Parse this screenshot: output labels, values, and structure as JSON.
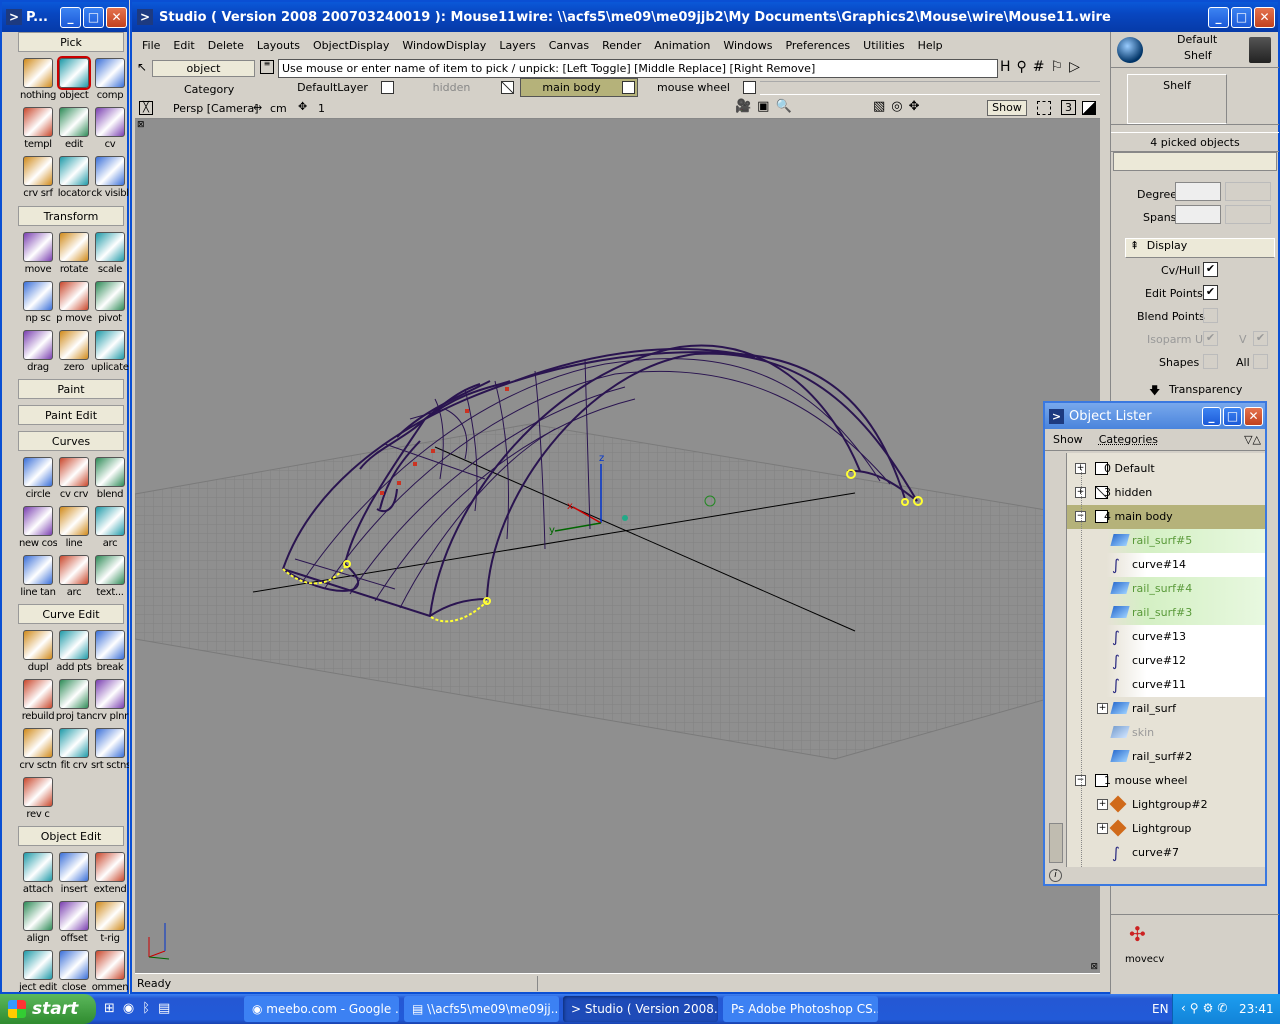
{
  "palette": {
    "title": "P...",
    "sections": {
      "pick": "Pick",
      "transform": "Transform",
      "paint": "Paint",
      "paint_edit": "Paint Edit",
      "curves": "Curves",
      "curve_edit": "Curve Edit",
      "object_edit": "Object Edit"
    },
    "pick_tools": [
      "nothing",
      "object",
      "comp",
      "templ",
      "edit",
      "cv",
      "crv srf",
      "locator",
      "ck visibl"
    ],
    "transform_tools": [
      "move",
      "rotate",
      "scale",
      "np sc",
      "p move",
      "pivot",
      "drag",
      "zero",
      "uplicatepl"
    ],
    "curves_tools": [
      "circle",
      "cv crv",
      "blend",
      "new cos",
      "line",
      "arc",
      "line tan",
      "arc",
      "text..."
    ],
    "curve_edit_tools": [
      "dupl",
      "add pts",
      "break",
      "rebuild",
      "proj tan",
      "crv plnr",
      "crv sctn",
      "fit crv",
      "srt sctns",
      "rev c"
    ],
    "object_edit_tools": [
      "attach",
      "insert",
      "extend",
      "align",
      "offset",
      "t-rig",
      "ject edit",
      "close",
      "ommen"
    ]
  },
  "app": {
    "title": "Studio ( Version 2008  200703240019 ): Mouse11wire: \\\\acfs5\\me09\\me09jjb2\\My Documents\\Graphics2\\Mouse\\wire\\Mouse11.wire",
    "menu": [
      "File",
      "Edit",
      "Delete",
      "Layouts",
      "ObjectDisplay",
      "WindowDisplay",
      "Layers",
      "Canvas",
      "Render",
      "Animation",
      "Windows",
      "Preferences",
      "Utilities",
      "Help"
    ],
    "pick_field": "object",
    "prompt": "Use mouse or enter name of item to pick / unpick: [Left Toggle] [Middle Replace] [Right Remove]",
    "category": "Category",
    "layers": [
      "DefaultLayer",
      "hidden",
      "main body",
      "mouse wheel"
    ],
    "viewport_label": "Persp [Camera]",
    "units": "cm",
    "view_num": "1",
    "show_btn": "Show",
    "panel_num": "3",
    "status": "Ready"
  },
  "shelf": {
    "default_label": "Default",
    "shelf_label": "Shelf",
    "tab": "Shelf",
    "picked": "4 picked objects",
    "degree": "Degree",
    "spans": "Spans",
    "display": "Display",
    "cvhull": "Cv/Hull",
    "edit_points": "Edit Points",
    "blend_points": "Blend Points",
    "isoparm_u": "Isoparm U",
    "isoparm_v": "V",
    "shapes": "Shapes",
    "all": "All",
    "transparency": "Transparency",
    "movecv": "movecv"
  },
  "lister": {
    "title": "Object Lister",
    "show": "Show",
    "categories": "Categories",
    "rows": [
      {
        "label": "0 Default",
        "indent": 0,
        "type": "layer",
        "exp": "+",
        "hl": ""
      },
      {
        "label": "3 hidden",
        "indent": 0,
        "type": "layer-x",
        "exp": "+",
        "hl": ""
      },
      {
        "label": "4 main body",
        "indent": 0,
        "type": "layer",
        "exp": "-",
        "hl": "olive"
      },
      {
        "label": "rail_surf#5",
        "indent": 1,
        "type": "surf",
        "exp": "",
        "hl": "green"
      },
      {
        "label": "curve#14",
        "indent": 1,
        "type": "curve",
        "exp": "",
        "hl": "white"
      },
      {
        "label": "rail_surf#4",
        "indent": 1,
        "type": "surf",
        "exp": "",
        "hl": "green"
      },
      {
        "label": "rail_surf#3",
        "indent": 1,
        "type": "surf",
        "exp": "",
        "hl": "green"
      },
      {
        "label": "curve#13",
        "indent": 1,
        "type": "curve",
        "exp": "",
        "hl": "white"
      },
      {
        "label": "curve#12",
        "indent": 1,
        "type": "curve",
        "exp": "",
        "hl": "white"
      },
      {
        "label": "curve#11",
        "indent": 1,
        "type": "curve",
        "exp": "",
        "hl": "white"
      },
      {
        "label": "rail_surf",
        "indent": 1,
        "type": "surf",
        "exp": "+",
        "hl": ""
      },
      {
        "label": "skin",
        "indent": 1,
        "type": "surf-dim",
        "exp": "",
        "hl": ""
      },
      {
        "label": "rail_surf#2",
        "indent": 1,
        "type": "surf",
        "exp": "",
        "hl": ""
      },
      {
        "label": "1 mouse wheel",
        "indent": 0,
        "type": "layer",
        "exp": "-",
        "hl": ""
      },
      {
        "label": "Lightgroup#2",
        "indent": 1,
        "type": "light",
        "exp": "+",
        "hl": ""
      },
      {
        "label": "Lightgroup",
        "indent": 1,
        "type": "light",
        "exp": "+",
        "hl": ""
      },
      {
        "label": "curve#7",
        "indent": 1,
        "type": "curve",
        "exp": "",
        "hl": ""
      }
    ]
  },
  "taskbar": {
    "start": "start",
    "tasks": [
      "meebo.com - Google ...",
      "\\\\acfs5\\me09\\me09jj...",
      "Studio ( Version 2008...",
      "Adobe Photoshop CS..."
    ],
    "lang": "EN",
    "clock": "23:41"
  },
  "colors": {
    "viewport": "#8f8f8f",
    "xp_blue": "#0a4fd3",
    "curve": "#2a1450",
    "highlight": "#ffff33"
  }
}
